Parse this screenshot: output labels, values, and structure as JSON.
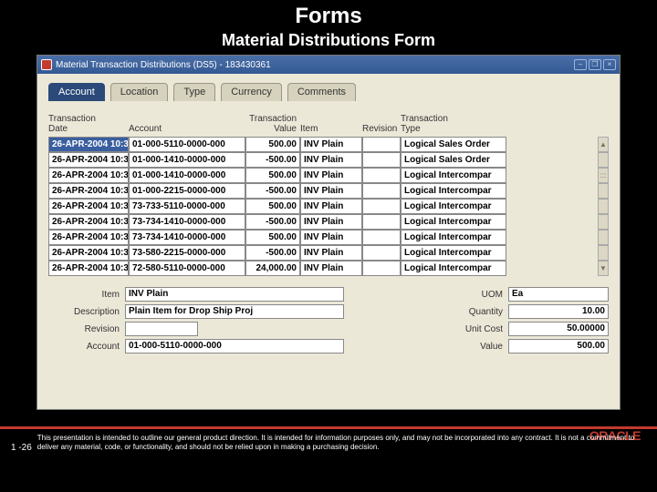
{
  "slide": {
    "title": "Forms",
    "subtitle": "Material Distributions Form",
    "page_number": "1 -26",
    "disclaimer": "This presentation is intended to outline our general product direction. It is intended for information purposes only, and may not be incorporated into any contract. It is not a commitment to deliver any material, code, or functionality, and should not be relied upon in making a purchasing decision.",
    "oracle_logo": "ORACLE"
  },
  "window": {
    "title": "Material Transaction Distributions (DS5) - 183430361"
  },
  "tabs": [
    {
      "label": "Account",
      "active": true
    },
    {
      "label": "Location",
      "active": false
    },
    {
      "label": "Type",
      "active": false
    },
    {
      "label": "Currency",
      "active": false
    },
    {
      "label": "Comments",
      "active": false
    }
  ],
  "columns": {
    "date": "Transaction\nDate",
    "account": "Account",
    "value": "Transaction\nValue",
    "item": "Item",
    "revision": "Revision",
    "type": "Transaction\nType"
  },
  "rows": [
    {
      "date": "26-APR-2004 10:3",
      "account": "01-000-5110-0000-000",
      "value": "500.00",
      "item": "INV Plain",
      "rev": "",
      "type": "Logical Sales Order"
    },
    {
      "date": "26-APR-2004 10:3",
      "account": "01-000-1410-0000-000",
      "value": "-500.00",
      "item": "INV Plain",
      "rev": "",
      "type": "Logical Sales Order"
    },
    {
      "date": "26-APR-2004 10:3",
      "account": "01-000-1410-0000-000",
      "value": "500.00",
      "item": "INV Plain",
      "rev": "",
      "type": "Logical Intercompar"
    },
    {
      "date": "26-APR-2004 10:3",
      "account": "01-000-2215-0000-000",
      "value": "-500.00",
      "item": "INV Plain",
      "rev": "",
      "type": "Logical Intercompar"
    },
    {
      "date": "26-APR-2004 10:3",
      "account": "73-733-5110-0000-000",
      "value": "500.00",
      "item": "INV Plain",
      "rev": "",
      "type": "Logical Intercompar"
    },
    {
      "date": "26-APR-2004 10:3",
      "account": "73-734-1410-0000-000",
      "value": "-500.00",
      "item": "INV Plain",
      "rev": "",
      "type": "Logical Intercompar"
    },
    {
      "date": "26-APR-2004 10:3",
      "account": "73-734-1410-0000-000",
      "value": "500.00",
      "item": "INV Plain",
      "rev": "",
      "type": "Logical Intercompar"
    },
    {
      "date": "26-APR-2004 10:3",
      "account": "73-580-2215-0000-000",
      "value": "-500.00",
      "item": "INV Plain",
      "rev": "",
      "type": "Logical Intercompar"
    },
    {
      "date": "26-APR-2004 10:3",
      "account": "72-580-5110-0000-000",
      "value": "24,000.00",
      "item": "INV Plain",
      "rev": "",
      "type": "Logical Intercompar"
    }
  ],
  "detail": {
    "item_label": "Item",
    "item_value": "INV Plain",
    "desc_label": "Description",
    "desc_value": "Plain Item for Drop Ship Proj",
    "rev_label": "Revision",
    "rev_value": "",
    "acct_label": "Account",
    "acct_value": "01-000-5110-0000-000",
    "uom_label": "UOM",
    "uom_value": "Ea",
    "qty_label": "Quantity",
    "qty_value": "10.00",
    "cost_label": "Unit Cost",
    "cost_value": "50.00000",
    "val_label": "Value",
    "val_value": "500.00"
  }
}
